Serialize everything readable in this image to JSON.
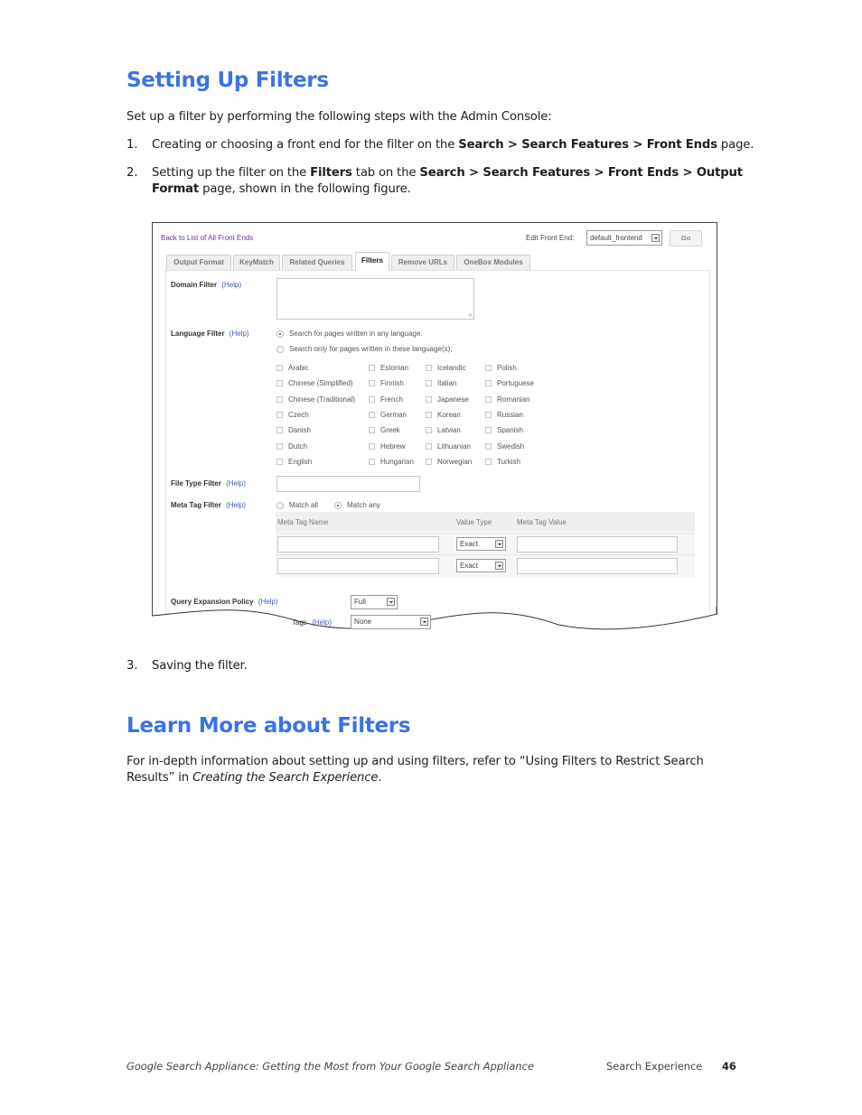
{
  "section1": {
    "title": "Setting Up Filters",
    "intro": "Set up a filter by performing the following steps with the Admin Console:",
    "steps": [
      {
        "number": "1.",
        "parts": [
          {
            "text": "Creating or choosing a front end for the filter on the ",
            "bold": false
          },
          {
            "text": "Search > Search Features > Front Ends",
            "bold": true
          },
          {
            "text": " page.",
            "bold": false
          }
        ]
      },
      {
        "number": "2.",
        "line1": [
          {
            "text": "Setting up the filter on the ",
            "bold": false
          },
          {
            "text": "Filters",
            "bold": true
          },
          {
            "text": " tab on the ",
            "bold": false
          },
          {
            "text": "Search > Search Features > Front Ends > Output",
            "bold": true
          }
        ],
        "line2": [
          {
            "text": "Format",
            "bold": true
          },
          {
            "text": " page, shown in the following figure.",
            "bold": false
          }
        ]
      },
      {
        "number": "3.",
        "text": "Saving the filter."
      }
    ]
  },
  "figure": {
    "back_link": "Back to List of All Front Ends",
    "edit_front_end_label": "Edit Front End:",
    "front_end_select": "default_frontend",
    "go_button": "Go",
    "tabs": [
      {
        "label": "Output Format",
        "active": false
      },
      {
        "label": "KeyMatch",
        "active": false
      },
      {
        "label": "Related Queries",
        "active": false
      },
      {
        "label": "Filters",
        "active": true
      },
      {
        "label": "Remove URLs",
        "active": false
      },
      {
        "label": "OneBox Modules",
        "active": false
      }
    ],
    "help_label": "(Help)",
    "domain_filter": {
      "label": "Domain Filter",
      "value": ""
    },
    "language_filter": {
      "label": "Language Filter",
      "options": [
        {
          "label": "Search for pages written in any language.",
          "selected": true
        },
        {
          "label": "Search only for pages written in these language(s):",
          "selected": false
        }
      ],
      "languages": [
        [
          "Arabic",
          "Chinese (Simplified)",
          "Chinese (Traditional)",
          "Czech",
          "Danish",
          "Dutch",
          "English"
        ],
        [
          "Estonian",
          "Finnish",
          "French",
          "German",
          "Greek",
          "Hebrew",
          "Hungarian"
        ],
        [
          "Icelandic",
          "Italian",
          "Japanese",
          "Korean",
          "Latvian",
          "Lithuanian",
          "Norwegian"
        ],
        [
          "Polish",
          "Portuguese",
          "Romanian",
          "Russian",
          "Spanish",
          "Swedish",
          "Turkish"
        ]
      ]
    },
    "file_type_filter": {
      "label": "File Type Filter",
      "value": ""
    },
    "meta_tag_filter": {
      "label": "Meta Tag Filter",
      "match_options": [
        {
          "label": "Match all",
          "selected": false
        },
        {
          "label": "Match any",
          "selected": true
        }
      ],
      "columns": [
        "Meta Tag Name",
        "Value Type",
        "Meta Tag Value"
      ],
      "rows": [
        {
          "name": "",
          "value_type": "Exact",
          "value": ""
        },
        {
          "name": "",
          "value_type": "Exact",
          "value": ""
        }
      ]
    },
    "query_expansion": {
      "label": "Query Expansion Policy",
      "value": "Full"
    },
    "tags": {
      "label": "Tags",
      "value": "None"
    }
  },
  "section2": {
    "title": "Learn More about Filters",
    "line1": "For in-depth information about setting up and using filters, refer to “Using Filters to Restrict Search",
    "line2_prefix": "Results” in ",
    "line2_italic": "Creating the Search Experience",
    "line2_suffix": "."
  },
  "footer": {
    "book_title": "Google Search Appliance: Getting the Most from Your Google Search Appliance",
    "chapter": "Search Experience",
    "page_number": "46"
  }
}
